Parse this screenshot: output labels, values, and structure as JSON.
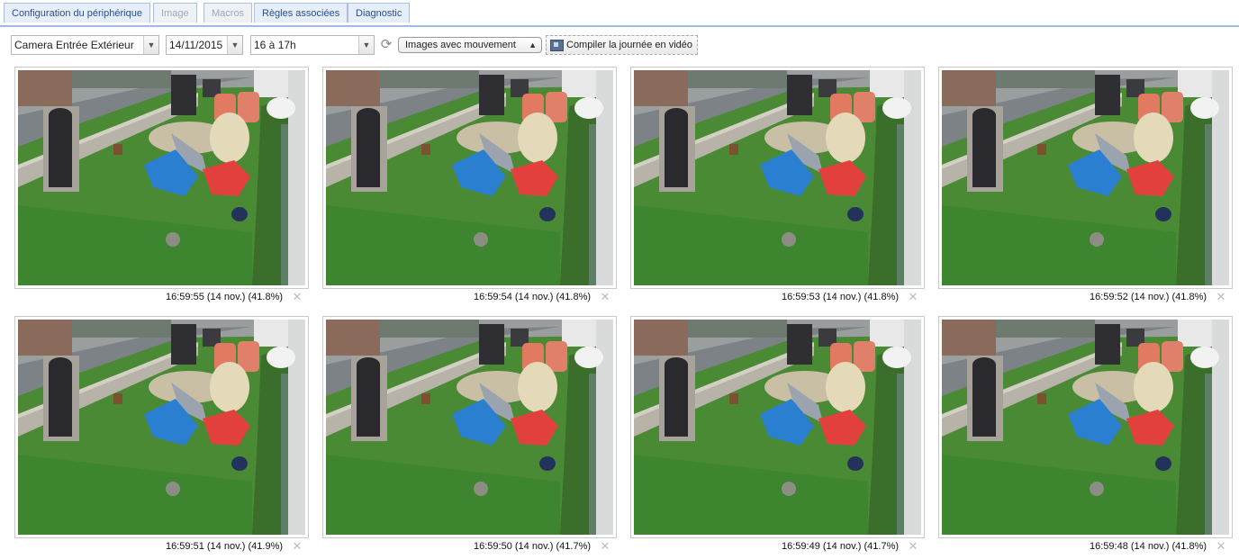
{
  "tabs": [
    {
      "label": "Configuration du périphérique",
      "enabled": true
    },
    {
      "label": "Image",
      "enabled": false
    },
    {
      "label": "Macros",
      "enabled": false
    },
    {
      "label": "Règles associées",
      "enabled": true
    },
    {
      "label": "Diagnostic",
      "enabled": true
    }
  ],
  "toolbar": {
    "camera": "Camera Entrée Extérieur",
    "date": "14/11/2015",
    "hour": "16 à 17h",
    "filter": "Images avec mouvement",
    "compile_label": "Compiler la journée en vidéo",
    "refresh_icon": "refresh-icon",
    "compile_icon": "film-icon"
  },
  "images": [
    {
      "caption": "16:59:55 (14 nov.) (41.8%)"
    },
    {
      "caption": "16:59:54 (14 nov.) (41.8%)"
    },
    {
      "caption": "16:59:53 (14 nov.) (41.8%)"
    },
    {
      "caption": "16:59:52 (14 nov.) (41.8%)"
    },
    {
      "caption": "16:59:51 (14 nov.) (41.9%)"
    },
    {
      "caption": "16:59:50 (14 nov.) (41.7%)"
    },
    {
      "caption": "16:59:49 (14 nov.) (41.7%)"
    },
    {
      "caption": "16:59:48 (14 nov.) (41.8%)"
    }
  ],
  "colors": {
    "tab_border": "#aac0de",
    "tab_text": "#2a4f8a",
    "grass": "#3f8a2e",
    "tarp_blue": "#2a7fd0",
    "tarp_red": "#e2403c"
  }
}
